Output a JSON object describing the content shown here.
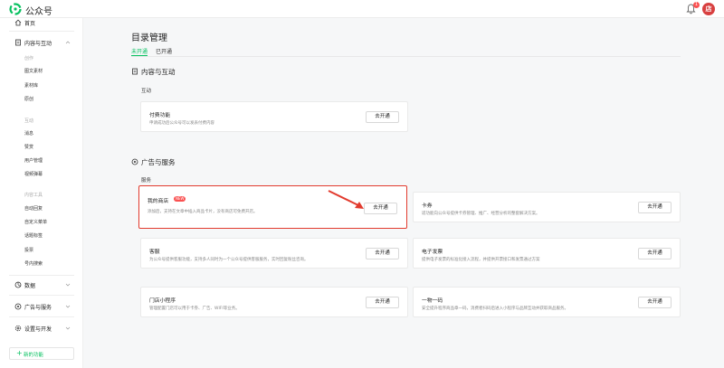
{
  "header": {
    "brand": "公众号",
    "notification_count": "1",
    "avatar_text": "店"
  },
  "sidebar": {
    "home": "首页",
    "content_section": {
      "label": "内容与互动",
      "group_create": "创作",
      "create_items": [
        "图文素材",
        "素材库",
        "原创"
      ],
      "group_interact": "互动",
      "interact_items": [
        "消息",
        "赞赏",
        "用户管理",
        "视频弹幕"
      ],
      "group_tools": "内容工具",
      "tool_items": [
        "自动回复",
        "自定义菜单",
        "话题标签",
        "投票",
        "号内搜索"
      ]
    },
    "data": "数据",
    "ads": "广告与服务",
    "settings": "设置与开发",
    "new_feature": "新的功能"
  },
  "main": {
    "title": "目录管理",
    "tabs": [
      "未开通",
      "已开通"
    ],
    "section1": {
      "title": "内容与互动",
      "subtitle": "互动",
      "cards": [
        {
          "title": "付费功能",
          "desc": "申请成功后公众号可以发表付费内容",
          "button": "去开通"
        }
      ]
    },
    "section2": {
      "title": "广告与服务",
      "subtitle": "服务",
      "cards": [
        {
          "title": "我的商店",
          "tag": "NEW",
          "desc": "添加后，支持在文章中插入商品卡片，没有商店可免费开店。",
          "button": "去开通"
        },
        {
          "title": "卡券",
          "desc": "适功能向公众号提供卡券管理、推广、经营分析的整套解决方案。",
          "button": "去开通"
        },
        {
          "title": "客服",
          "desc": "为公众号提供客服功能，支持多人同时为一个公众号提供客服服务，实时回复粉丝咨询。",
          "button": "去开通"
        },
        {
          "title": "电子发票",
          "desc": "提供电子发票的标准化接入流程，并提供开票接口和发票通过方案",
          "button": "去开通"
        },
        {
          "title": "门店小程序",
          "desc": "管理配置门店可以用于卡券、广告、WIFI等业务。",
          "button": "去开通"
        },
        {
          "title": "一物一码",
          "desc": "安全提升程序商品章一码，消费者扫码后进入小程序与品牌互动并获取商品服务。",
          "button": "去开通"
        }
      ]
    }
  },
  "colors": {
    "accent": "#07c160",
    "highlight": "#e23b2e",
    "badge": "#fa5151"
  }
}
